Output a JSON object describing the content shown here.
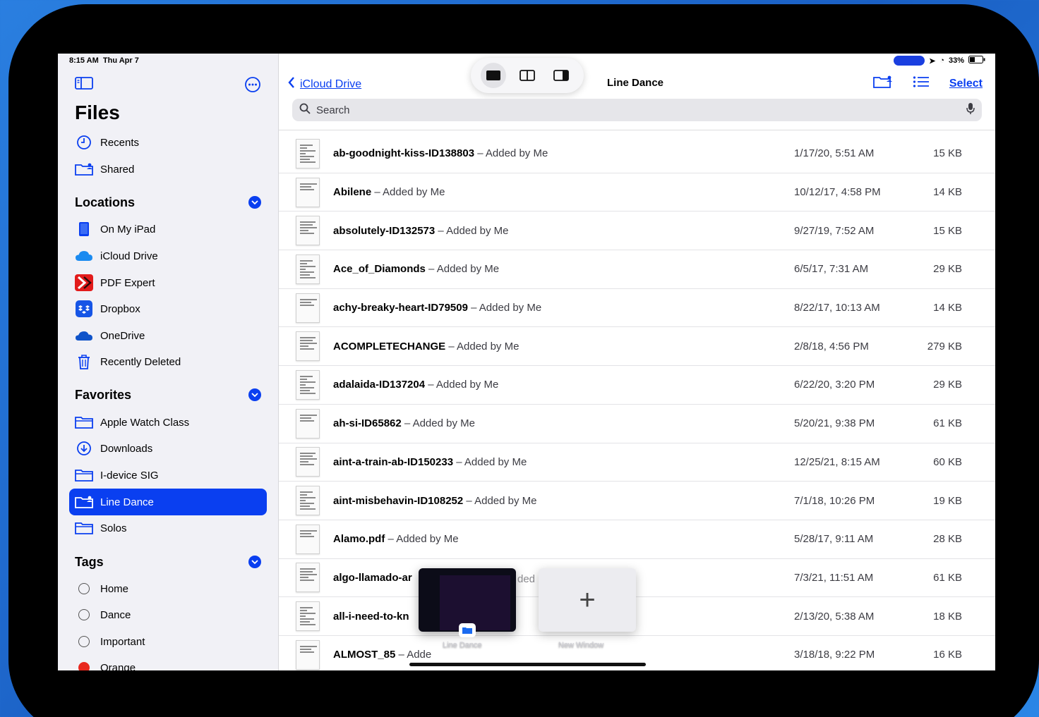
{
  "status": {
    "time": "8:15 AM",
    "date": "Thu Apr 7",
    "battery": "33%"
  },
  "sidebar": {
    "title": "Files",
    "top_items": [
      {
        "label": "Recents",
        "icon": "clock-icon"
      },
      {
        "label": "Shared",
        "icon": "shared-folder-icon"
      }
    ],
    "locations_header": "Locations",
    "locations": [
      {
        "label": "On My iPad",
        "icon": "ipad-icon"
      },
      {
        "label": "iCloud Drive",
        "icon": "icloud-icon"
      },
      {
        "label": "PDF Expert",
        "icon": "pdf-expert-icon"
      },
      {
        "label": "Dropbox",
        "icon": "dropbox-icon"
      },
      {
        "label": "OneDrive",
        "icon": "onedrive-icon"
      },
      {
        "label": "Recently Deleted",
        "icon": "trash-icon"
      }
    ],
    "favorites_header": "Favorites",
    "favorites": [
      {
        "label": "Apple Watch Class",
        "icon": "folder-icon"
      },
      {
        "label": "Downloads",
        "icon": "download-icon"
      },
      {
        "label": "I-device SIG",
        "icon": "folder-icon"
      },
      {
        "label": "Line Dance",
        "icon": "shared-folder-icon",
        "selected": true
      },
      {
        "label": "Solos",
        "icon": "folder-icon"
      }
    ],
    "tags_header": "Tags",
    "tags": [
      {
        "label": "Home",
        "color": ""
      },
      {
        "label": "Dance",
        "color": ""
      },
      {
        "label": "Important",
        "color": ""
      },
      {
        "label": "Orange",
        "color": "#e8281e"
      }
    ]
  },
  "main": {
    "back_label": "iCloud Drive",
    "title": "Line Dance",
    "select_label": "Select",
    "search_placeholder": "Search",
    "files": [
      {
        "name": "ab-goodnight-kiss-ID138803",
        "added": " – Added by Me",
        "date": "1/17/20, 5:51 AM",
        "size": "15 KB"
      },
      {
        "name": "Abilene",
        "added": " – Added by Me",
        "date": "10/12/17, 4:58 PM",
        "size": "14 KB"
      },
      {
        "name": "absolutely-ID132573",
        "added": " – Added by Me",
        "date": "9/27/19, 7:52 AM",
        "size": "15 KB"
      },
      {
        "name": "Ace_of_Diamonds",
        "added": " – Added by Me",
        "date": "6/5/17, 7:31 AM",
        "size": "29 KB"
      },
      {
        "name": "achy-breaky-heart-ID79509",
        "added": " – Added by Me",
        "date": "8/22/17, 10:13 AM",
        "size": "14 KB"
      },
      {
        "name": "ACOMPLETECHANGE",
        "added": " – Added by Me",
        "date": "2/8/18, 4:56 PM",
        "size": "279 KB"
      },
      {
        "name": "adalaida-ID137204",
        "added": " – Added by Me",
        "date": "6/22/20, 3:20 PM",
        "size": "29 KB"
      },
      {
        "name": "ah-si-ID65862",
        "added": " – Added by Me",
        "date": "5/20/21, 9:38 PM",
        "size": "61 KB"
      },
      {
        "name": "aint-a-train-ab-ID150233",
        "added": " – Added by Me",
        "date": "12/25/21, 8:15 AM",
        "size": "60 KB"
      },
      {
        "name": "aint-misbehavin-ID108252",
        "added": " – Added by Me",
        "date": "7/1/18, 10:26 PM",
        "size": "19 KB"
      },
      {
        "name": "Alamo.pdf",
        "added": " – Added by Me",
        "date": "5/28/17, 9:11 AM",
        "size": "28 KB"
      },
      {
        "name": "algo-llamado-ar",
        "added": "",
        "date": "7/3/21, 11:51 AM",
        "size": "61 KB"
      },
      {
        "name": "all-i-need-to-kn",
        "added": "",
        "date": "2/13/20, 5:38 AM",
        "size": "18 KB"
      },
      {
        "name": "ALMOST_85",
        "added": " – Adde",
        "date": "3/18/18, 9:22 PM",
        "size": "16 KB"
      }
    ]
  },
  "shelf": {
    "window_label": "Line Dance",
    "new_window_label": "New Window",
    "partial_text": "ded"
  },
  "colors": {
    "accent": "#0a3ff0",
    "sidebar_bg": "#f1f1f6"
  }
}
